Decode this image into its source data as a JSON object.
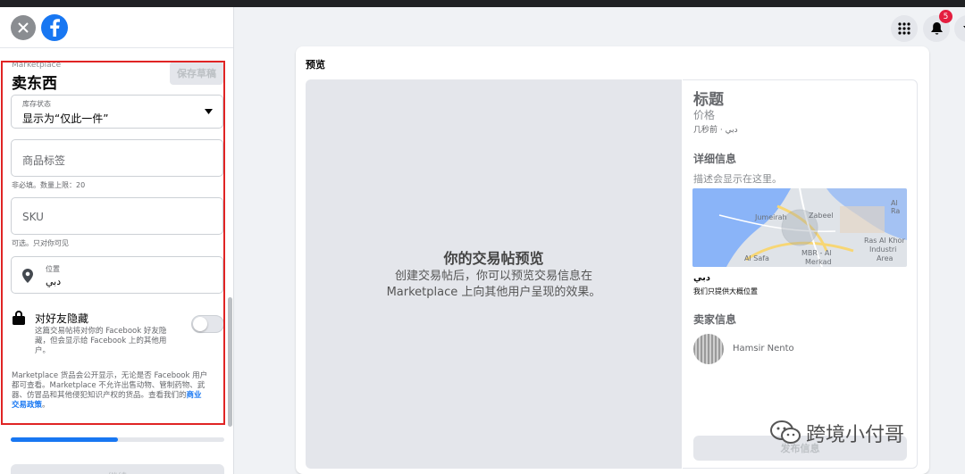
{
  "form": {
    "marketplace_label": "Marketplace",
    "title": "卖东西",
    "save_draft": "保存草稿",
    "stock": {
      "label": "库存状态",
      "value": "显示为“仅此一件”"
    },
    "tags": {
      "placeholder": "商品标签",
      "hint": "非必填。数量上限：20"
    },
    "sku": {
      "placeholder": "SKU",
      "hint": "可选。只对你可见"
    },
    "location": {
      "label": "位置",
      "value": "دبي"
    },
    "hide_friends": {
      "title": "对好友隐藏",
      "line1": "这篇交易帖将对你的 Facebook 好友隐",
      "line2": "藏，但会显示给 Facebook 上的其他用",
      "line3": "户。"
    },
    "policy": {
      "line1": "Marketplace 货品会公开显示，无论是否 Facebook 用户",
      "line2": "都可查看。Marketplace 不允许出售动物、管制药物、武",
      "line3": "器、仿冒品和其他侵犯知识产权的货品。查看我们的",
      "link1": "商业",
      "link2": "交易政策",
      "end": "。"
    },
    "progress_pct": 0.5,
    "next": "继续"
  },
  "header": {
    "notification_count": "5"
  },
  "preview": {
    "label": "预览",
    "area_title": "你的交易帖预览",
    "area_line1": "创建交易帖后，你可以预览交易信息在",
    "area_line2": "Marketplace 上向其他用户呈现的效果。",
    "title": "标题",
    "price": "价格",
    "time": "几秒前 · دبي",
    "details_heading": "详细信息",
    "details_desc": "描述会显示在这里。",
    "map_labels": [
      "Jumeirah",
      "Zabeel",
      "Al Ra",
      "Ras Al Khor",
      "Industri",
      "Area",
      "MBR - Al",
      "Merkad",
      "Al Safa"
    ],
    "city": "دبي",
    "approx": "我们只提供大概位置",
    "seller_heading": "卖家信息",
    "seller_name": "Hamsir Nento",
    "publish": "发布信息"
  },
  "watermark": "跨境小付哥"
}
